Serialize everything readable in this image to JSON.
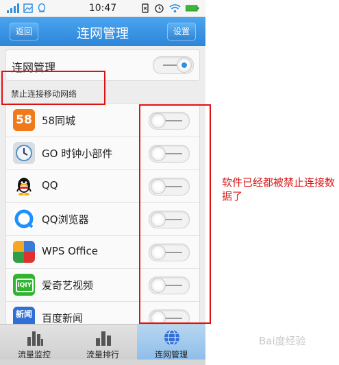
{
  "status_bar": {
    "time": "10:47",
    "icons_left": [
      "signal-icon",
      "image-icon",
      "qq-icon"
    ],
    "icons_right": [
      "sync-icon",
      "alarm-icon",
      "wifi-icon",
      "battery-icon"
    ]
  },
  "header": {
    "back_label": "返回",
    "title": "连网管理",
    "settings_label": "设置",
    "color": "#2d85d8"
  },
  "master_toggle": {
    "label": "连网管理",
    "state": "on"
  },
  "section_label": "禁止连接移动网络",
  "apps": [
    {
      "name": "58同城",
      "icon": "58-icon",
      "toggle": "off"
    },
    {
      "name": "GO 时钟小部件",
      "icon": "clock-icon",
      "toggle": "off"
    },
    {
      "name": "QQ",
      "icon": "qq-penguin-icon",
      "toggle": "off"
    },
    {
      "name": "QQ浏览器",
      "icon": "qq-browser-icon",
      "toggle": "off"
    },
    {
      "name": "WPS Office",
      "icon": "wps-icon",
      "toggle": "off"
    },
    {
      "name": "爱奇艺视频",
      "icon": "iqiyi-icon",
      "toggle": "off"
    },
    {
      "name": "百度新闻",
      "icon": "baidu-news-icon",
      "toggle": "off"
    }
  ],
  "app_icon_texts": {
    "58": "58",
    "iqiyi": "iQIY",
    "baidu_news": "新闻"
  },
  "tabs": [
    {
      "label": "流量监控",
      "icon": "bar-chart-icon",
      "active": false
    },
    {
      "label": "流量排行",
      "icon": "ranking-icon",
      "active": false
    },
    {
      "label": "连网管理",
      "icon": "globe-icon",
      "active": true
    }
  ],
  "annotation": "软件已经都被禁止连接数据了",
  "watermark": "Bai度经验",
  "colors": {
    "annotation_red": "#e01010",
    "active_tab": "#8ebde9",
    "toggle_on_dot": "#2f8fe0"
  }
}
